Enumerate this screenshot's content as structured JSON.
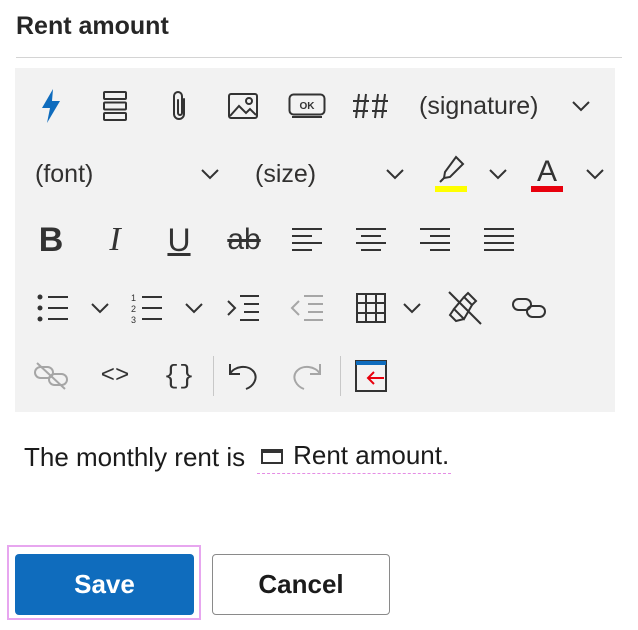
{
  "header": {
    "title": "Rent amount"
  },
  "toolbar": {
    "row1": [
      {
        "icon": "lightning-icon",
        "tooltip": ""
      },
      {
        "icon": "rows-icon"
      },
      {
        "icon": "paperclip-icon"
      },
      {
        "icon": "image-icon"
      },
      {
        "icon": "ok-button-icon",
        "label": "OK"
      },
      {
        "icon": "hash-icon",
        "label": "##"
      }
    ],
    "signature_dropdown": "(signature)",
    "font_dropdown": "(font)",
    "size_dropdown": "(size)",
    "font_color_letter": "A",
    "bold_letter": "B",
    "italic_letter": "I",
    "underline_letter": "U",
    "strike_letters": "ab",
    "braces": "{}",
    "code": "<>",
    "highlight_color": "#ffff00",
    "font_color": "#e8000d",
    "accent_color": "#0f6cbd"
  },
  "content": {
    "text": "The monthly rent is",
    "token_label": "Rent amount."
  },
  "buttons": {
    "save": "Save",
    "cancel": "Cancel"
  }
}
